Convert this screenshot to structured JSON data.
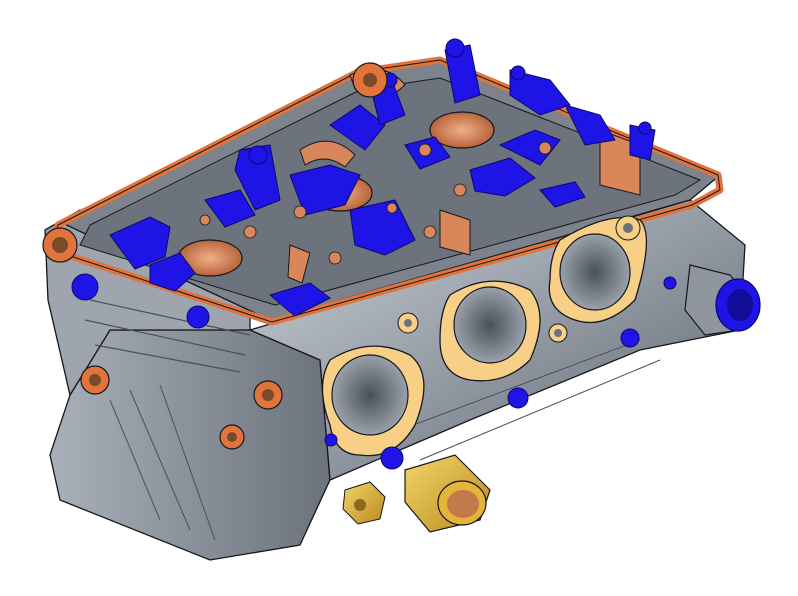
{
  "scene": {
    "subject": "cylinder-head-cad-model",
    "colors": {
      "background": "#ffffff",
      "casting": "#8f96a0",
      "casting_light": "#c7ccd3",
      "casting_dark": "#4a5058",
      "outline": "#15181c",
      "highlight_blue": "#1f14e6",
      "gasket_orange": "#e0743c",
      "bore_copper": "#d9875a",
      "port_gasket": "#f7cf86",
      "fitting_gold": "#e2b53a"
    }
  }
}
